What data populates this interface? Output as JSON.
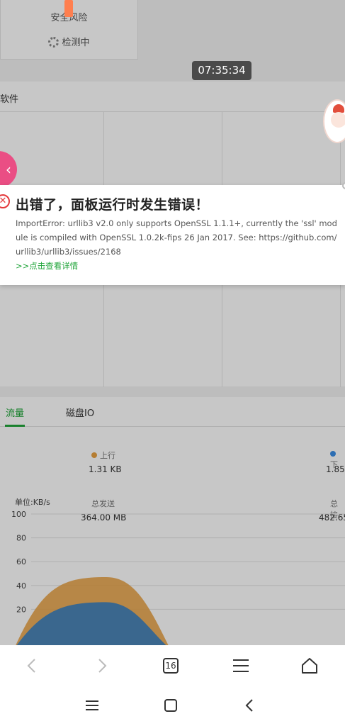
{
  "risk": {
    "title": "安全风险",
    "status": "检测中"
  },
  "clock": {
    "time": "07:35:34"
  },
  "software": {
    "title": "软件"
  },
  "error": {
    "title": "出错了，面板运行时发生错误！",
    "message": "ImportError: urllib3 v2.0 only supports OpenSSL 1.1.1+, currently the 'ssl' module is compiled with OpenSSL 1.0.2k-fips 26 Jan 2017. See: https://github.com/urllib3/urllib3/issues/2168",
    "link": ">>点击查看详情",
    "accent": "#e4393c"
  },
  "traffic": {
    "tabs": [
      {
        "label": "流量",
        "active": true
      },
      {
        "label": "磁盘IO",
        "active": false
      }
    ],
    "upload": {
      "label": "上行",
      "value": "1.31 KB",
      "color": "#f0a030"
    },
    "download": {
      "label": "下",
      "value": "1.85",
      "color": "#3a8ee6"
    },
    "total_sent": {
      "label": "总发送",
      "value": "364.00 MB"
    },
    "total_recv": {
      "label": "总接",
      "value": "482.65"
    },
    "unit": "单位:KB/s"
  },
  "chart_data": {
    "type": "area",
    "ylim": [
      0,
      100
    ],
    "yticks": [
      "100",
      "80",
      "60",
      "40",
      "20"
    ],
    "series": [
      {
        "name": "上行",
        "color": "#e8a040",
        "peak": 47
      },
      {
        "name": "下",
        "color": "#3a7fc0",
        "peak": 26
      }
    ]
  },
  "toolbar": {
    "tab_count": "16"
  },
  "colors": {
    "brand": "#20a53a",
    "pink": "#ea4e84"
  }
}
